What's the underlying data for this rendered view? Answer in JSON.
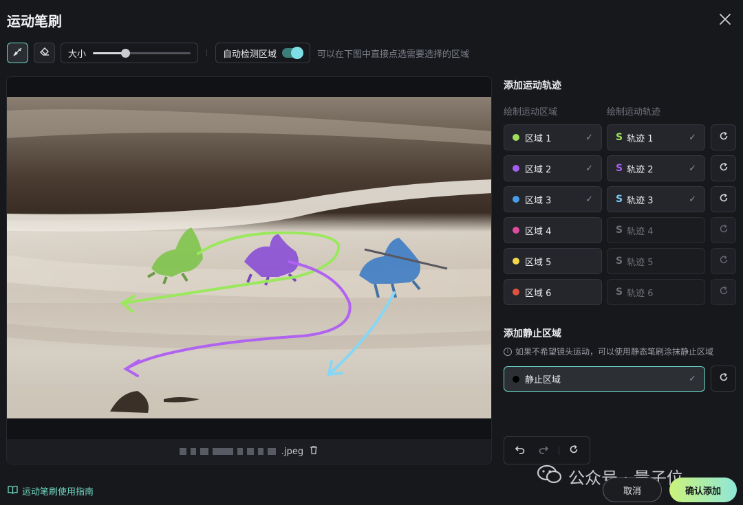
{
  "dialog": {
    "title": "运动笔刷"
  },
  "toolbar": {
    "size_label": "大小",
    "size_value": 0.33,
    "auto_detect_label": "自动检测区域",
    "auto_detect_on": true,
    "hint": "可以在下图中直接点选需要选择的区域"
  },
  "canvas": {
    "file_ext": ".jpeg"
  },
  "motion": {
    "title": "添加运动轨迹",
    "area_col": "绘制运动区域",
    "traj_col": "绘制运动轨迹",
    "rows": [
      {
        "area": "区域 1",
        "traj": "轨迹 1",
        "color": "#9ddf5c",
        "traj_color": "#9ddf5c",
        "done": true
      },
      {
        "area": "区域 2",
        "traj": "轨迹 2",
        "color": "#a15ef0",
        "traj_color": "#a15ef0",
        "done": true
      },
      {
        "area": "区域 3",
        "traj": "轨迹 3",
        "color": "#4a9be8",
        "traj_color": "#7cc9f2",
        "done": true
      },
      {
        "area": "区域 4",
        "traj": "轨迹 4",
        "color": "#de4ba0",
        "traj_color": "#6e7078",
        "done": false
      },
      {
        "area": "区域 5",
        "traj": "轨迹 5",
        "color": "#f3d54a",
        "traj_color": "#6e7078",
        "done": false
      },
      {
        "area": "区域 6",
        "traj": "轨迹 6",
        "color": "#e0523f",
        "traj_color": "#6e7078",
        "done": false
      }
    ]
  },
  "static": {
    "title": "添加静止区域",
    "info": "如果不希望镜头运动，可以使用静态笔刷涂抹静止区域",
    "area_label": "静止区域",
    "color": "#000000"
  },
  "footer": {
    "guide": "运动笔刷使用指南",
    "cancel": "取消",
    "confirm": "确认添加",
    "watermark": "公众号 · 量子位"
  }
}
